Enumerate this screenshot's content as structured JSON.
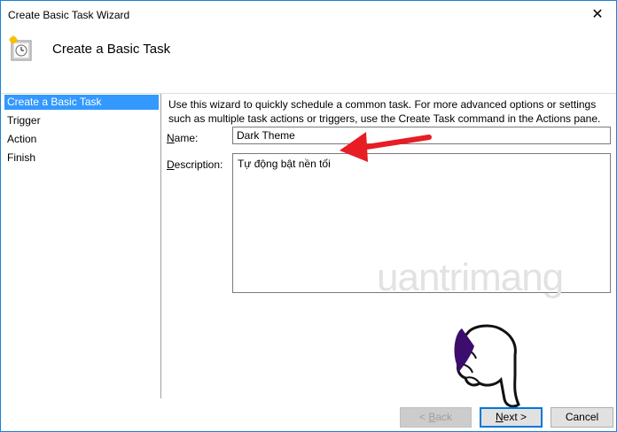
{
  "window": {
    "title": "Create Basic Task Wizard",
    "close_glyph": "✕"
  },
  "header": {
    "title": "Create a Basic Task",
    "icon": "task-scheduler-clock-icon"
  },
  "nav": {
    "items": [
      {
        "label": "Create a Basic Task",
        "active": true
      },
      {
        "label": "Trigger",
        "active": false
      },
      {
        "label": "Action",
        "active": false
      },
      {
        "label": "Finish",
        "active": false
      }
    ]
  },
  "intro": "Use this wizard to quickly schedule a common task.  For more advanced options or settings such as multiple task actions or triggers, use the Create Task command in the Actions pane.",
  "form": {
    "name_label_key": "N",
    "name_label_rest": "ame:",
    "name_value": "Dark Theme",
    "description_label_key": "D",
    "description_label_rest": "escription:",
    "description_value": "Tự động bật nền tối"
  },
  "buttons": {
    "back_prefix": "< ",
    "back_key": "B",
    "back_rest": "ack",
    "next_key": "N",
    "next_rest": "ext >",
    "cancel": "Cancel"
  },
  "watermark": "uantrimang",
  "colors": {
    "selection": "#3399ff",
    "annotation_arrow": "#e81c24",
    "window_border": "#1883d7",
    "hand_glove": "#ffffff",
    "hand_cuff": "#3c0d6c"
  }
}
